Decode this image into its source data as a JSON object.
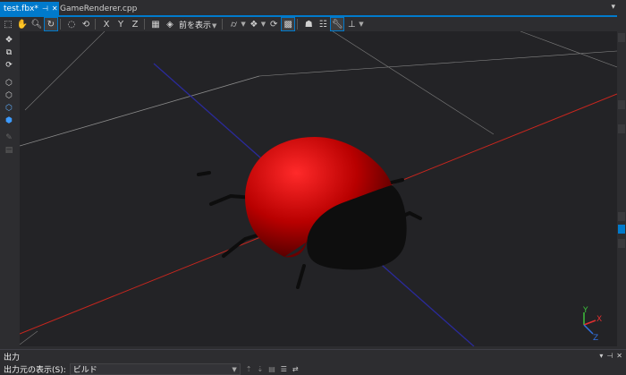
{
  "tabs": [
    {
      "label": "test.fbx*",
      "active": true
    },
    {
      "label": "GameRenderer.cpp",
      "active": false
    }
  ],
  "tab_icons": {
    "pin": "pin-icon",
    "close": "close-icon"
  },
  "toolbar": {
    "view_label": "前を表示",
    "icons": [
      "select-icon",
      "pan-icon",
      "zoom-icon",
      "orbit-icon",
      "frame-icon",
      "tumble-icon",
      "move-x-icon",
      "scale-y-icon",
      "rotate-z-icon",
      "grid-icon",
      "view-cube-icon",
      "shape-icon",
      "render-mode-icon",
      "reset-icon",
      "grid-toggle-icon",
      "lighting-icon",
      "wireframe-icon",
      "properties-icon",
      "pivot-icon"
    ]
  },
  "left_tools": [
    "translate-icon",
    "scale-icon",
    "rotate-icon",
    "add-cube-icon",
    "add-cube-outline-icon",
    "add-cube-select-icon",
    "add-cube-solid-icon",
    "brush-icon",
    "clipboard-icon"
  ],
  "viewport": {
    "axis_gizmo": {
      "x": "X",
      "y": "Y",
      "z": "Z"
    },
    "colors": {
      "background": "#232326",
      "model_red": "#c80000",
      "x_line": "#c8261e",
      "z_line": "#2a2a9a",
      "grid": "#8a8a8a"
    }
  },
  "output": {
    "title": "出力",
    "show_from_label": "出力元の表示(S):",
    "show_from_value": "ビルド"
  },
  "accent": "#007acc"
}
